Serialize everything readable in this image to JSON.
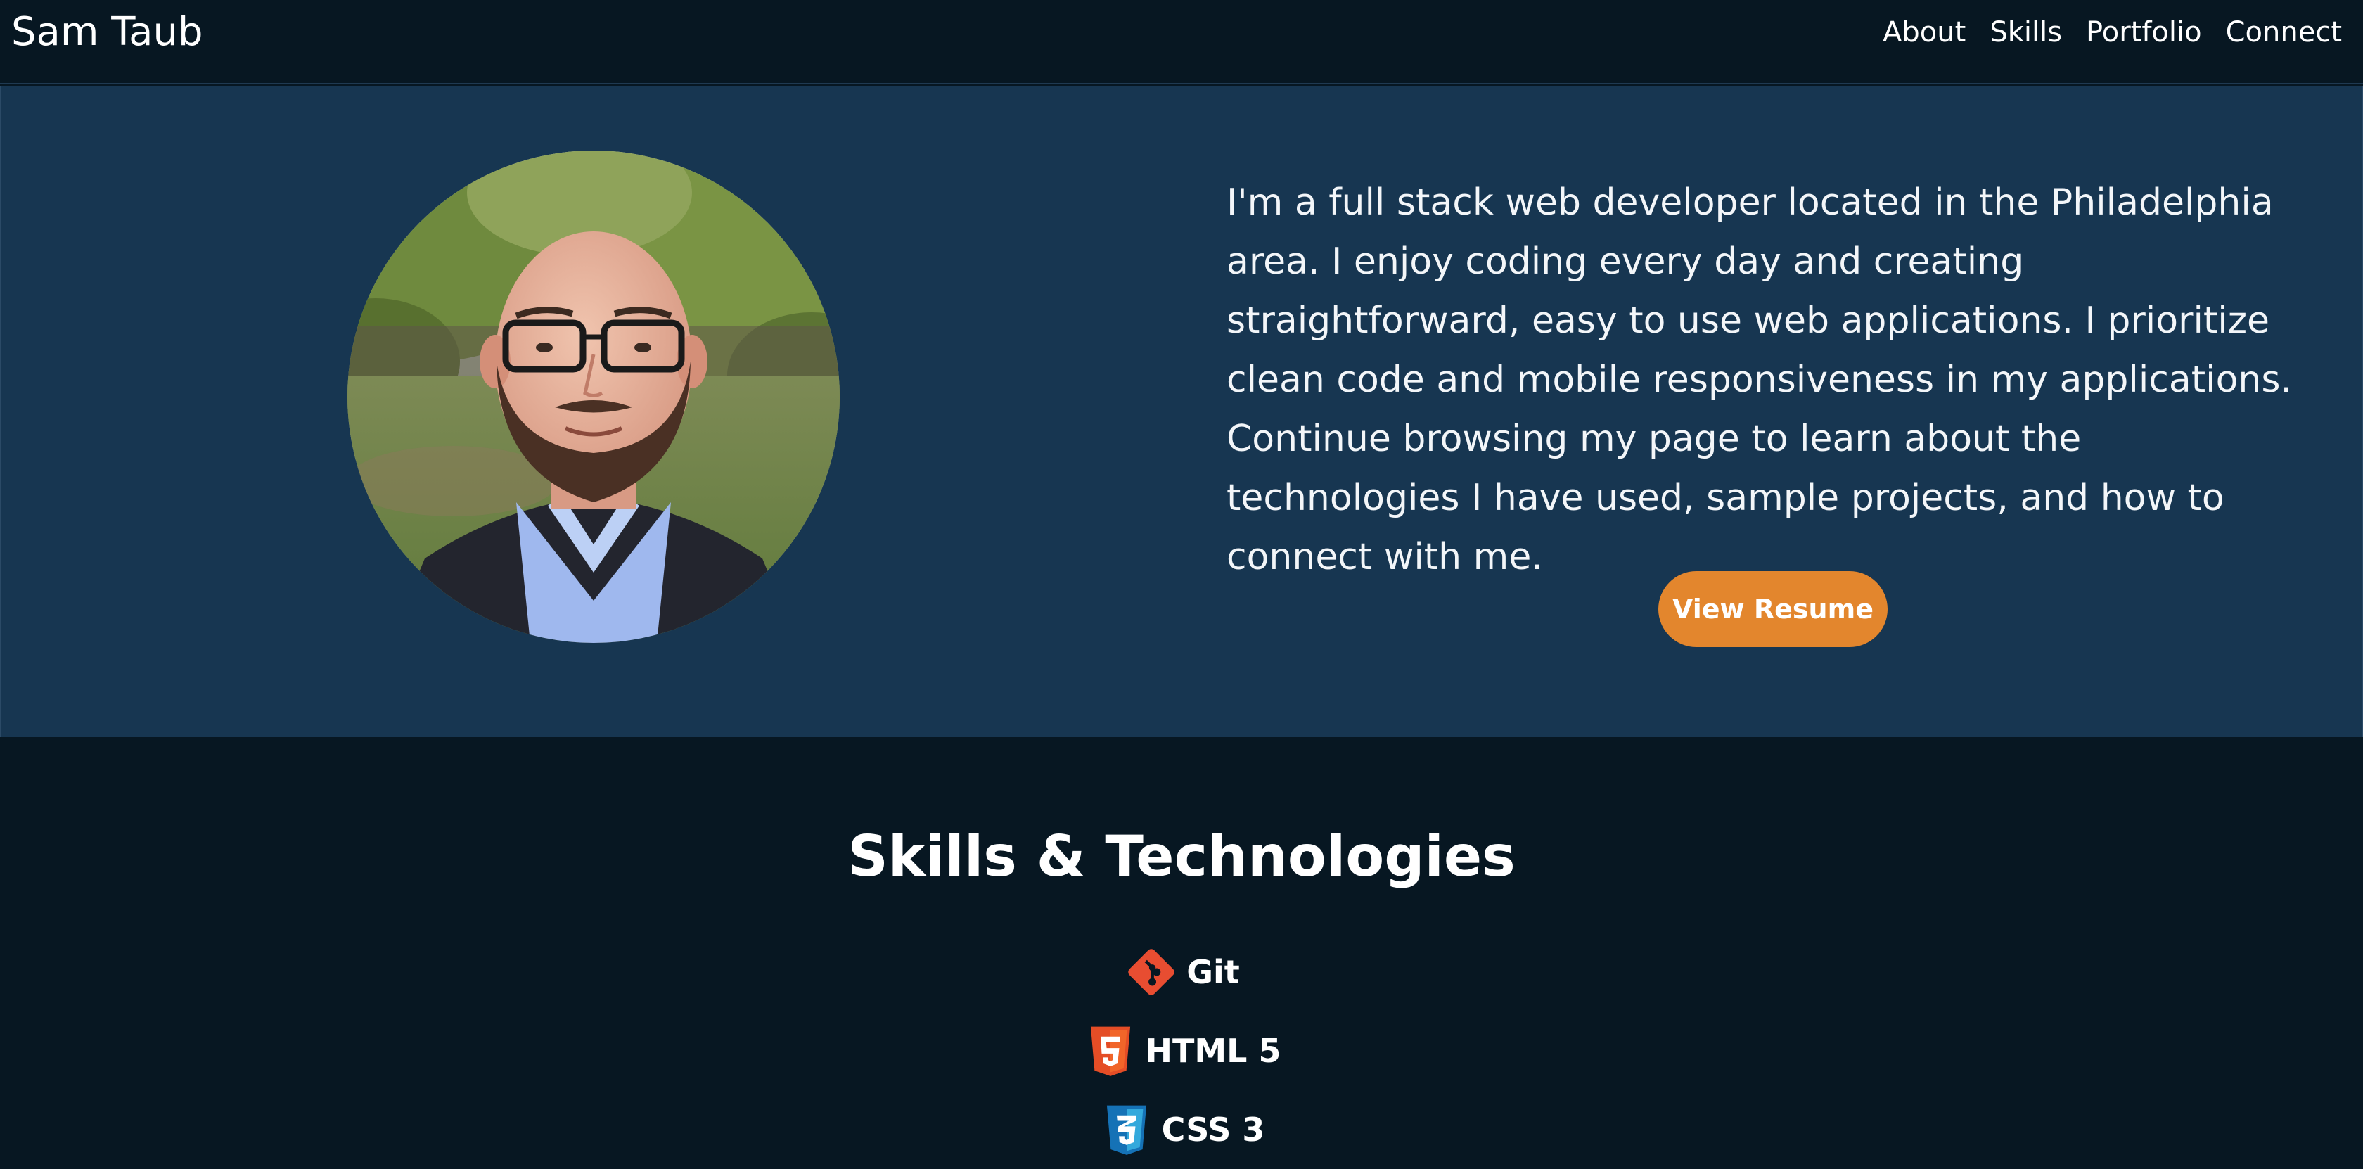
{
  "navbar": {
    "brand": "Sam Taub",
    "links": [
      {
        "label": "About"
      },
      {
        "label": "Skills"
      },
      {
        "label": "Portfolio"
      },
      {
        "label": "Connect"
      }
    ]
  },
  "about": {
    "bio": "I'm a full stack web developer located in the Philadelphia area. I enjoy coding every day and creating straightforward, easy to use web applications. I prioritize clean code and mobile responsiveness in my applications. Continue browsing my page to learn about the technologies I have used, sample projects, and how to connect with me.",
    "resume_button": "View Resume"
  },
  "skills": {
    "title": "Skills & Technologies",
    "items": [
      {
        "label": "Git",
        "icon": "git-icon"
      },
      {
        "label": "HTML 5",
        "icon": "html5-icon"
      },
      {
        "label": "CSS 3",
        "icon": "css3-icon"
      }
    ]
  },
  "colors": {
    "navbar_bg": "#071722",
    "about_bg": "#173651",
    "skills_bg": "#071722",
    "accent": "#e3862d",
    "git": "#e84d31",
    "html5": "#e44d26",
    "css3": "#1572b6"
  }
}
